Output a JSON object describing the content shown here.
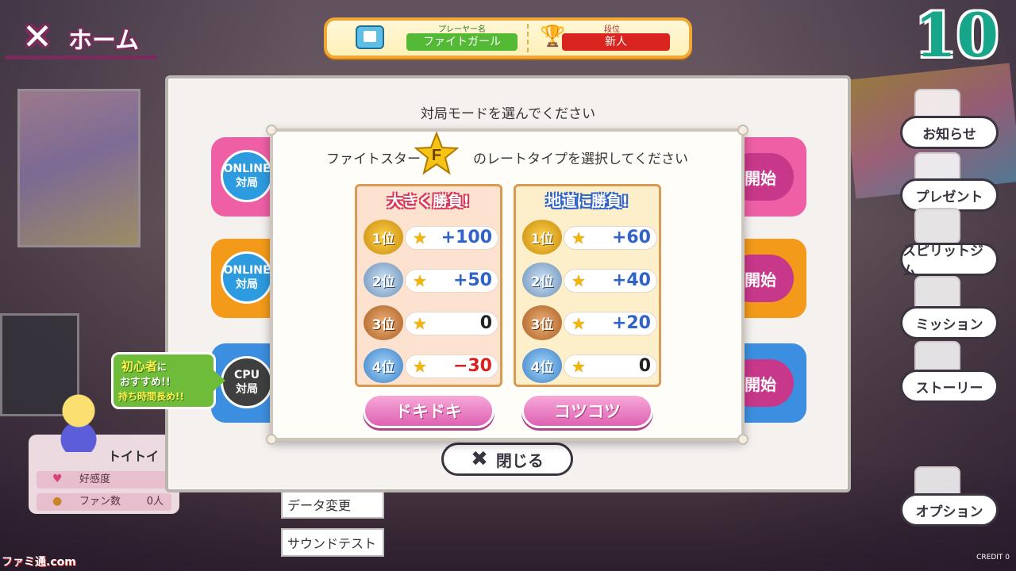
{
  "home": {
    "label": "ホーム"
  },
  "player": {
    "name_label": "プレーヤー名",
    "name_value": "ファイトガール",
    "rank_label": "段位",
    "rank_value": "新人"
  },
  "timer": "10",
  "side_menu": [
    "お知らせ",
    "プレゼント",
    "スピリットジム",
    "ミッション",
    "ストーリー",
    "オプション"
  ],
  "mode_dialog": {
    "title": "対局モードを選んでください",
    "modes": [
      {
        "circle_line1": "ONLINE",
        "circle_line2": "対局",
        "color": "#ee5fa6",
        "start_label": "開始"
      },
      {
        "circle_line1": "ONLINE",
        "circle_line2": "対局",
        "color": "#f39a1a",
        "start_label": "開始"
      },
      {
        "circle_line1": "CPU",
        "circle_line2": "対局",
        "color": "#3f3f3f",
        "start_label": "開始"
      }
    ],
    "close_label": "閉じる"
  },
  "beginner_badge": {
    "line1": "初心者",
    "line1_suffix": "に",
    "line2": "おすすめ!!",
    "line3": "持ち時間長め!!"
  },
  "character": {
    "name": "トイトイ",
    "affection_label": "好感度",
    "fans_label": "ファン数",
    "fans_value": "0人"
  },
  "bottom_menu": [
    "データ変更",
    "サウンドテスト"
  ],
  "rate_dialog": {
    "title_before": "ファイトスター",
    "star_symbol": "F",
    "title_after": "のレートタイプを選択してください",
    "options": [
      {
        "heading": "大きく勝負!",
        "button": "ドキドキ",
        "rows": [
          {
            "rank": "1位",
            "value": "+100",
            "color": "#2f63c8"
          },
          {
            "rank": "2位",
            "value": "+50",
            "color": "#2f63c8"
          },
          {
            "rank": "3位",
            "value": "0",
            "color": "#222222"
          },
          {
            "rank": "4位",
            "value": "−30",
            "color": "#d7231f"
          }
        ]
      },
      {
        "heading": "地道に勝負!",
        "button": "コツコツ",
        "rows": [
          {
            "rank": "1位",
            "value": "+60",
            "color": "#2f63c8"
          },
          {
            "rank": "2位",
            "value": "+40",
            "color": "#2f63c8"
          },
          {
            "rank": "3位",
            "value": "+20",
            "color": "#2f63c8"
          },
          {
            "rank": "4位",
            "value": "0",
            "color": "#222222"
          }
        ]
      }
    ]
  },
  "credit": "CREDIT 0",
  "watermark": "ファミ通.com"
}
